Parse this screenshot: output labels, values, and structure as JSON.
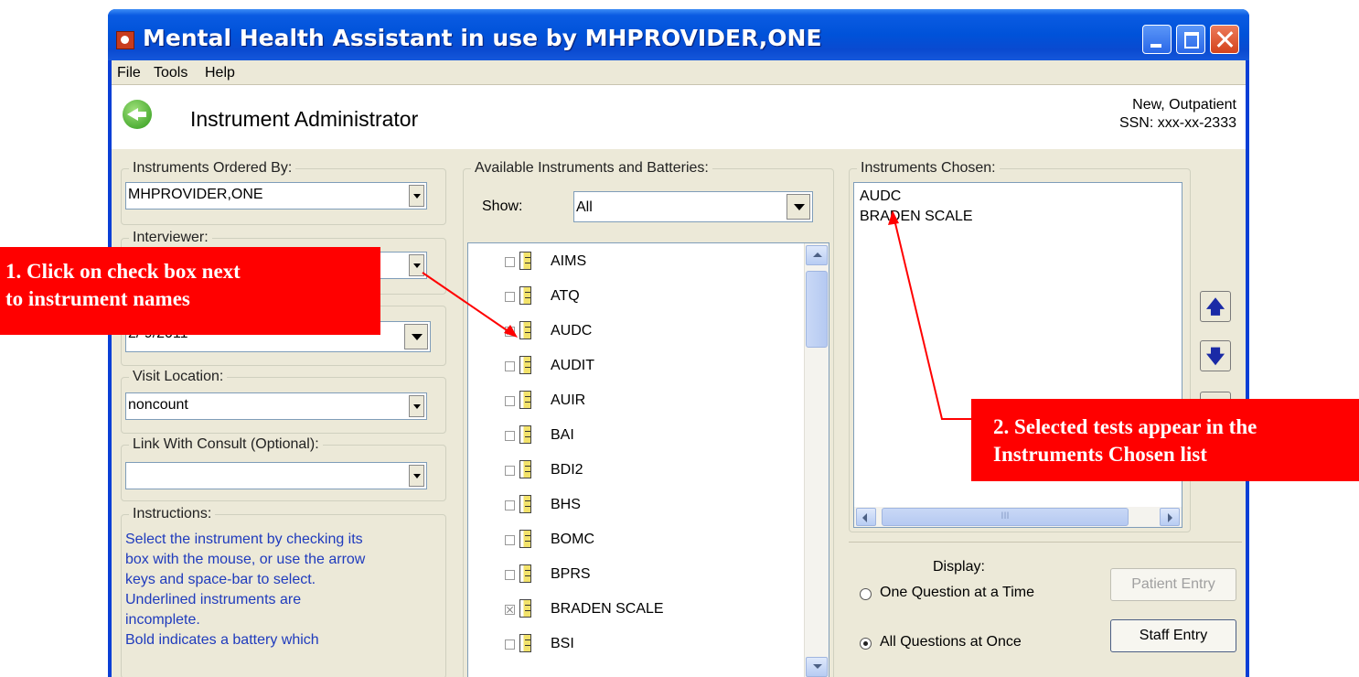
{
  "window": {
    "title": "Mental Health Assistant in use by MHPROVIDER,ONE"
  },
  "menu": {
    "file": "File",
    "tools": "Tools",
    "help": "Help"
  },
  "header": {
    "title": "Instrument Administrator",
    "patient_line1": "New, Outpatient",
    "patient_line2": "SSN: xxx-xx-2333"
  },
  "left": {
    "ordered_by": {
      "label": "Instruments Ordered By:",
      "value": "MHPROVIDER,ONE"
    },
    "interviewer": {
      "label": "Interviewer:",
      "value": ""
    },
    "date": {
      "value": "2/ 9/2011"
    },
    "visit_location": {
      "label": "Visit Location:",
      "value": "noncount"
    },
    "consult": {
      "label": "Link With Consult (Optional):",
      "value": ""
    },
    "instructions": {
      "label": "Instructions:",
      "lines": [
        " Select the instrument by checking its",
        "box with the mouse, or use the arrow",
        "keys and space-bar to select.",
        "  Underlined instruments are",
        "incomplete.",
        "  Bold indicates a battery which"
      ]
    }
  },
  "available": {
    "label": "Available Instruments and Batteries:",
    "show_label": "Show:",
    "show_value": "All",
    "items": [
      {
        "name": "AIMS",
        "checked": false
      },
      {
        "name": "ATQ",
        "checked": false
      },
      {
        "name": "AUDC",
        "checked": true
      },
      {
        "name": "AUDIT",
        "checked": false
      },
      {
        "name": "AUIR",
        "checked": false
      },
      {
        "name": "BAI",
        "checked": false
      },
      {
        "name": "BDI2",
        "checked": false
      },
      {
        "name": "BHS",
        "checked": false
      },
      {
        "name": "BOMC",
        "checked": false
      },
      {
        "name": "BPRS",
        "checked": false
      },
      {
        "name": "BRADEN SCALE",
        "checked": true
      },
      {
        "name": "BSI",
        "checked": false
      }
    ]
  },
  "chosen": {
    "label": "Instruments Chosen:",
    "items": [
      "AUDC",
      "BRADEN SCALE"
    ],
    "scroll_h_label": "III"
  },
  "display": {
    "label": "Display:",
    "option1": "One Question at a Time",
    "option2": "All Questions at Once",
    "selected": "option2",
    "patient_entry": "Patient Entry",
    "staff_entry": "Staff Entry"
  },
  "move_buttons": {
    "up": "🡅",
    "down": "🡇",
    "remove": "⇦"
  },
  "callouts": {
    "one": [
      "1. Click on check box next",
      "to instrument names"
    ],
    "two": [
      "2. Selected tests appear in the",
      "Instruments Chosen list"
    ]
  },
  "colors": {
    "titlebar": "#0052d9",
    "callout": "#ff0000",
    "instructions_text": "#1f3bbd"
  }
}
